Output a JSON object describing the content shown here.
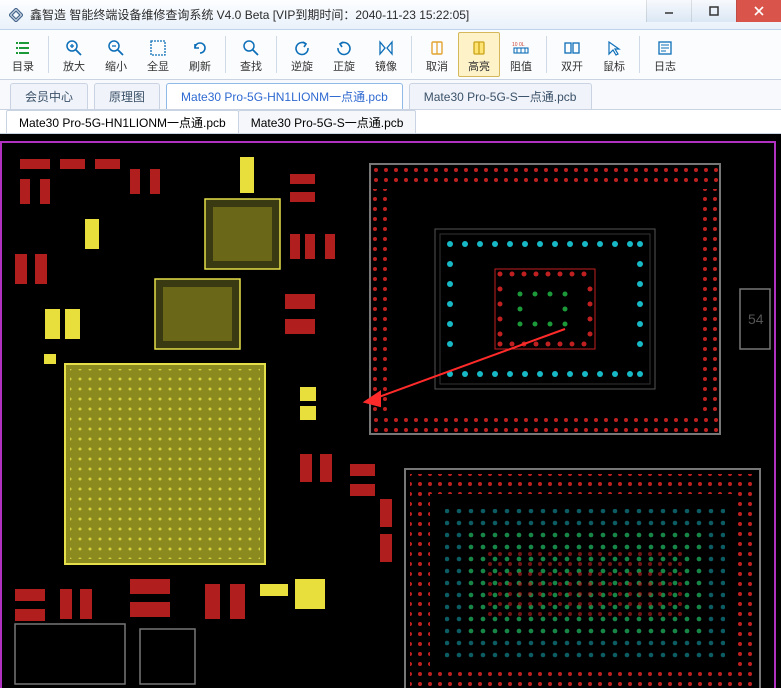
{
  "window": {
    "title": "鑫智造 智能终端设备维修查询系统 V4.0 Beta [VIP到期时间：2040-11-23 15:22:05]"
  },
  "toolbar": {
    "items": [
      {
        "label": "目录"
      },
      {
        "label": "放大"
      },
      {
        "label": "缩小"
      },
      {
        "label": "全显"
      },
      {
        "label": "刷新"
      },
      {
        "label": "查找"
      },
      {
        "label": "逆旋"
      },
      {
        "label": "正旋"
      },
      {
        "label": "镜像"
      },
      {
        "label": "取消"
      },
      {
        "label": "高亮"
      },
      {
        "label": "阻值"
      },
      {
        "label": "双开"
      },
      {
        "label": "鼠标"
      },
      {
        "label": "日志"
      }
    ]
  },
  "navTabs": [
    {
      "label": "会员中心",
      "active": false
    },
    {
      "label": "原理图",
      "active": false
    },
    {
      "label": "Mate30 Pro-5G-HN1LIONM一点通.pcb",
      "active": true
    },
    {
      "label": "Mate30 Pro-5G-S一点通.pcb",
      "active": false
    }
  ],
  "docTabs": [
    {
      "label": "Mate30 Pro-5G-HN1LIONM一点通.pcb",
      "active": true
    },
    {
      "label": "Mate30 Pro-5G-S一点通.pcb",
      "active": false
    }
  ],
  "pcb": {
    "label_54": "54"
  }
}
